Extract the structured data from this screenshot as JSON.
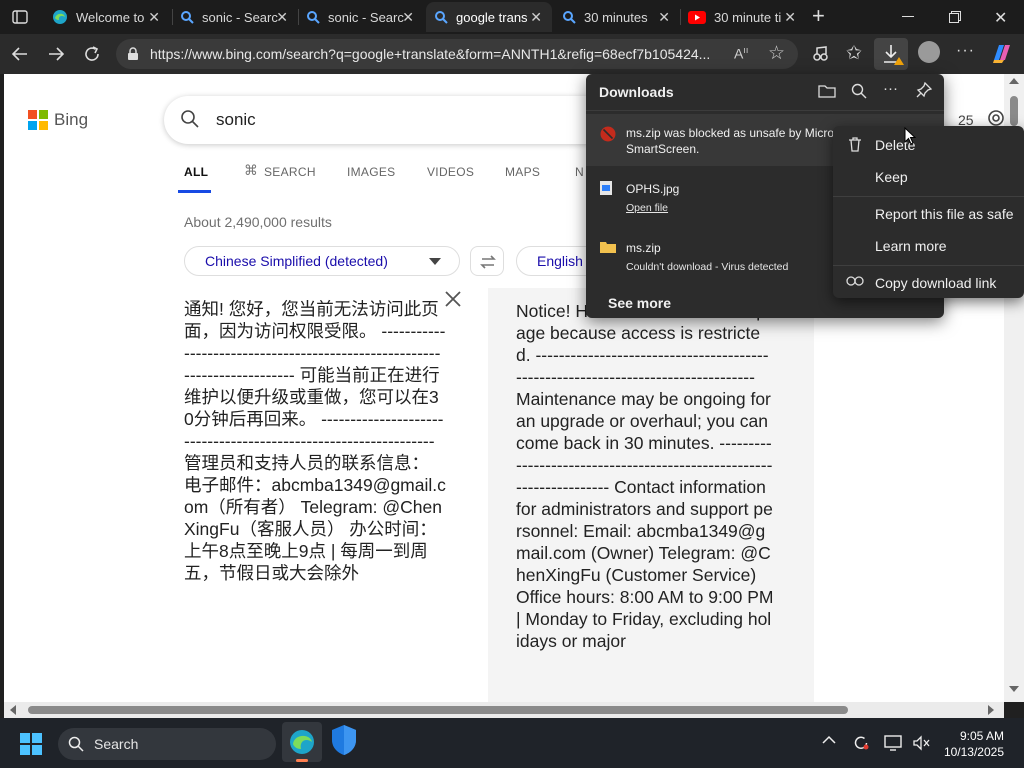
{
  "tabs": [
    {
      "title": "Welcome to",
      "icon": "edge-icon",
      "active": false
    },
    {
      "title": "sonic - Searc",
      "icon": "bing-search-icon",
      "active": false
    },
    {
      "title": "sonic - Searc",
      "icon": "bing-search-icon",
      "active": false
    },
    {
      "title": "google trans",
      "icon": "bing-search-icon",
      "active": true
    },
    {
      "title": "30 minutes",
      "icon": "bing-search-icon",
      "active": false
    },
    {
      "title": "30 minute ti",
      "icon": "youtube-icon",
      "active": false
    }
  ],
  "address_bar": {
    "url": "https://www.bing.com/search?q=google+translate&form=ANNTH1&refig=68ecf7b105424..."
  },
  "bing": {
    "logo_text": "Bing",
    "query": "sonic",
    "nav": [
      "ALL",
      "SEARCH",
      "IMAGES",
      "VIDEOS",
      "MAPS",
      "N"
    ],
    "results_count": "About 2,490,000 results",
    "peek_number": "25"
  },
  "translator": {
    "source_lang": "Chinese Simplified (detected)",
    "target_lang": "English",
    "source_text": "通知! 您好，您当前无法访问此页面，因为访问权限受限。 -------------------------------------------------------------------------- 可能当前正在进行维护以便升级或重做，您可以在30分钟后再回来。 ---------------------------------------------------------------- 管理员和支持人员的联系信息： 电子邮件：abcmba1349@gmail.com（所有者） Telegram: @ChenXingFu（客服人员） 办公时间：上午8点至晚上9点 | 每周一到周五，节假日或大会除外",
    "target_text": "Notice! H... cannot access this page because access is restricted. --------------------------------------------------------------------------------- Maintenance may be ongoing for an upgrade or overhaul; you can come back in 30 minutes. --------------------------------------------------------------------- Contact information for administrators and support personnel: Email: abcmba1349@gmail.com (Owner) Telegram: @ChenXingFu (Customer Service) Office hours: 8:00 AM to 9:00 PM | Monday to Friday, excluding holidays or major"
  },
  "downloads": {
    "title": "Downloads",
    "items": [
      {
        "name": "ms.zip was blocked as unsafe by Micros",
        "sub": "SmartScreen.",
        "icon": "blocked-icon"
      },
      {
        "name": "OPHS.jpg",
        "sub": "Open file",
        "icon": "image-file-icon"
      },
      {
        "name": "ms.zip",
        "sub": "Couldn't download - Virus detected",
        "icon": "folder-icon"
      }
    ],
    "see_more": "See more"
  },
  "context_menu": {
    "items": [
      "Delete",
      "Keep",
      "Report this file as safe",
      "Learn more",
      "Copy download link"
    ]
  },
  "taskbar": {
    "search_placeholder": "Search",
    "time": "9:05 AM",
    "date": "10/13/2025"
  },
  "colors": {
    "accent": "#174ae4",
    "blocked_red": "#c42b1c",
    "youtube_red": "#ff0000",
    "folder_yellow": "#f2c14e"
  }
}
